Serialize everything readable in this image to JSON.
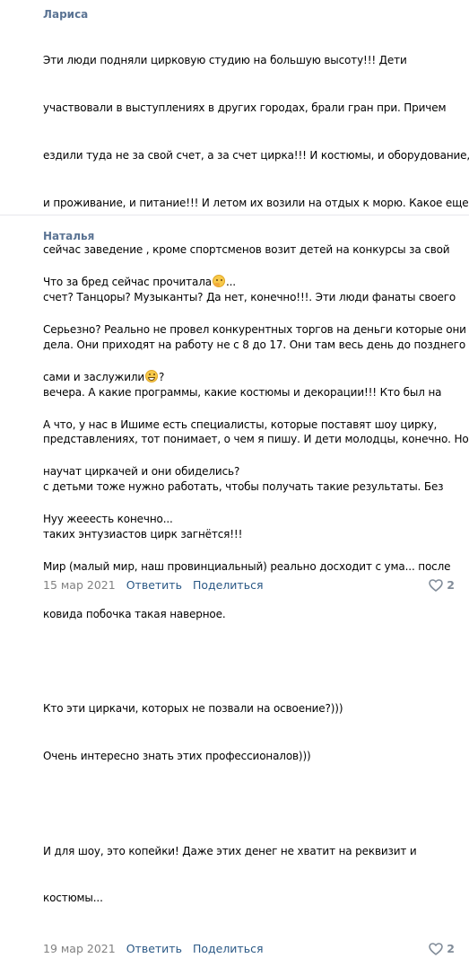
{
  "comments": [
    {
      "author": "Лариса",
      "lines": [
        "Эти люди подняли цирковую студию на большую высоту!!! Дети",
        "участвовали в выступлениях в других городах, брали гран при. Причем",
        "ездили туда не за свой счет, а за счет цирка!!! И костюмы, и оборудование,",
        "и проживание, и питание!!! И летом их возили на отдых к морю. Какое еще",
        "сейчас заведение , кроме спортсменов возит детей на конкурсы за свой",
        "счет? Танцоры? Музыканты? Да нет, конечно!!!. Эти люди фанаты своего",
        "дела. Они приходят на работу не с 8 до 17. Они там весь день до позднего",
        "вечера. А какие программы, какие костюмы и декорации!!! Кто был на",
        "представлениях, тот понимает, о чем я пишу. И дети молодцы, конечно. Но",
        "с детьми тоже нужно работать, чтобы получать такие результаты. Без",
        "таких энтузиастов цирк загнётся!!!"
      ],
      "date": "15 мар 2021",
      "reply_label": "Ответить",
      "share_label": "Поделиться",
      "likes": "2"
    },
    {
      "author": "Наталья",
      "line1_before_emoji": "Что за бред сейчас прочитала",
      "line1_after_emoji": "...",
      "line2": "Серьезно? Реально не провел конкурентных торгов на деньги которые они",
      "line3_before_emoji": "сами и заслужили",
      "line3_after_emoji": "?",
      "lines_rest": [
        "А что, у нас в Ишиме есть специалисты, которые поставят шоу цирку,",
        "научат циркачей и они обиделись?",
        "Нуу жееесть конечно...",
        "Мир (малый мир, наш провинциальный) реально досходит с ума... после",
        "ковида побочка такая наверное.",
        "",
        "Кто эти циркачи, которых не позвали на освоение?)))",
        "Очень интересно знать этих профессионалов)))",
        "",
        "И для шоу, это копейки! Даже этих денег не хватит на реквизит и",
        "костюмы..."
      ],
      "date": "19 мар 2021",
      "reply_label": "Ответить",
      "share_label": "Поделиться",
      "likes": "2"
    }
  ],
  "icons": {
    "thinking_emoji": "thinking-face-icon",
    "grin_emoji": "grinning-face-icon",
    "like_icon": "heart-outline-icon"
  },
  "colors": {
    "author": "#5b7494",
    "link": "#2a5885",
    "date": "#828282",
    "like": "#818c99",
    "divider": "#e7e8ec"
  }
}
